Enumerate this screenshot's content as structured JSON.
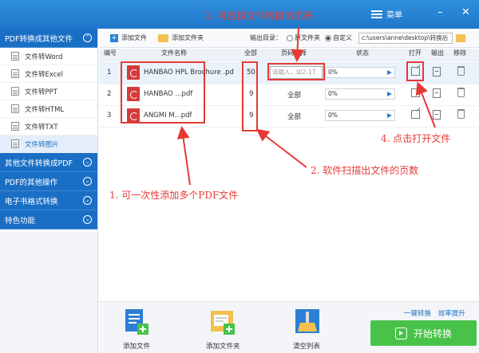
{
  "header": {
    "menu_label": "菜单",
    "minimize": "–",
    "close": "✕"
  },
  "sidebar": {
    "sections": [
      {
        "label": "PDF转换成其他文件"
      },
      {
        "label": "其他文件转换成PDF"
      },
      {
        "label": "PDF的其他操作"
      },
      {
        "label": "电子书格式转换"
      },
      {
        "label": "特色功能"
      }
    ],
    "items": [
      {
        "label": "文件转Word"
      },
      {
        "label": "文件转Excel"
      },
      {
        "label": "文件转PPT"
      },
      {
        "label": "文件转HTML"
      },
      {
        "label": "文件转TXT"
      },
      {
        "label": "文件转图片"
      }
    ]
  },
  "toolbar": {
    "add_file": "添加文件",
    "add_folder": "添加文件夹",
    "output_label": "输出目录：",
    "option_original": "原文件夹",
    "option_custom": "自定义",
    "path": "c:\\users\\anne\\desktop\\转换后"
  },
  "table": {
    "headers": [
      "编号",
      "文件名称",
      "全部",
      "页码选择",
      "状态",
      "打开",
      "输出",
      "移除"
    ],
    "page_placeholder": "请输入，如2-17",
    "rows": [
      {
        "num": "1",
        "name": "HANBAO HPL Brochure .pd",
        "pages": "50",
        "range": "",
        "status": "0%"
      },
      {
        "num": "2",
        "name": "HANBAO ...pdf",
        "pages": "9",
        "range": "全部",
        "status": "0%"
      },
      {
        "num": "3",
        "name": "ANGMI M...pdf",
        "pages": "9",
        "range": "全部",
        "status": "0%"
      }
    ]
  },
  "annotations": {
    "a1": "1. 可一次性添加多个PDF文件",
    "a2": "2. 软件扫描出文件的页数",
    "a3": "3. 可选择文件转换的页码",
    "a4": "4. 点击打开文件",
    "color": "#e53935"
  },
  "bottom": {
    "add_file": "添加文件",
    "add_folder": "添加文件夹",
    "clear": "清空列表",
    "link1": "一键转换",
    "link2": "效率提升",
    "start": "开始转换"
  },
  "colors": {
    "brand": "#1a6fc5",
    "start_button": "#49c24a"
  }
}
